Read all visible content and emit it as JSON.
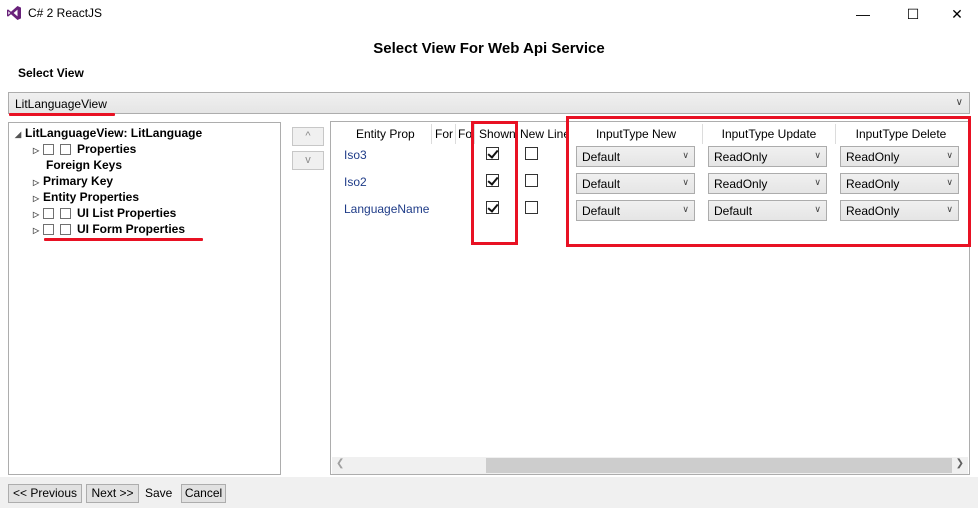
{
  "window": {
    "title": "C# 2 ReactJS",
    "minimize_glyph": "—",
    "maximize_glyph": "☐",
    "close_glyph": "✕"
  },
  "heading": "Select View For Web Api Service",
  "select_view_label": "Select View",
  "view_combo": {
    "value": "LitLanguageView"
  },
  "tree": {
    "root": "LitLanguageView: LitLanguage",
    "items": [
      {
        "label": "Properties"
      },
      {
        "label": "Foreign Keys"
      },
      {
        "label": "Primary Key"
      },
      {
        "label": "Entity Properties"
      },
      {
        "label": "UI List Properties"
      },
      {
        "label": "UI Form Properties"
      }
    ]
  },
  "buttons": {
    "up": "^",
    "down": "v",
    "previous": "<< Previous",
    "next": "Next >>",
    "save": "Save",
    "cancel": "Cancel"
  },
  "grid": {
    "columns": [
      "Entity Prop",
      "For",
      "Fo",
      "Shown",
      "New Line",
      "InputType New",
      "InputType Update",
      "InputType Delete"
    ],
    "rows": [
      {
        "entity_prop": "Iso3",
        "shown": true,
        "new_line": false,
        "input_new": "Default",
        "input_update": "ReadOnly",
        "input_delete": "ReadOnly"
      },
      {
        "entity_prop": "Iso2",
        "shown": true,
        "new_line": false,
        "input_new": "Default",
        "input_update": "ReadOnly",
        "input_delete": "ReadOnly"
      },
      {
        "entity_prop": "LanguageName",
        "shown": true,
        "new_line": false,
        "input_new": "Default",
        "input_update": "Default",
        "input_delete": "ReadOnly"
      }
    ]
  },
  "colors": {
    "highlight": "#e81123",
    "link_text": "#1f3c88",
    "app_icon": "#68217a"
  }
}
